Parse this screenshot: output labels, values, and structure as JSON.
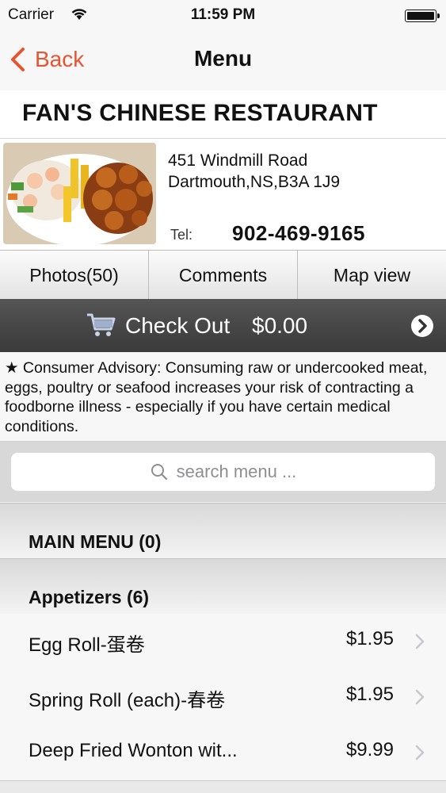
{
  "status_bar": {
    "carrier": "Carrier",
    "time": "11:59 PM"
  },
  "nav": {
    "back_label": "Back",
    "title": "Menu"
  },
  "restaurant": {
    "name": "FAN'S CHINESE RESTAURANT",
    "address_line1": "451 Windmill Road",
    "address_line2": "Dartmouth,NS,B3A 1J9",
    "tel_label": "Tel:",
    "tel": "902-469-9165"
  },
  "tabs": [
    {
      "label": "Photos(50)"
    },
    {
      "label": "Comments"
    },
    {
      "label": "Map view"
    }
  ],
  "checkout": {
    "label": "Check Out",
    "amount": "$0.00"
  },
  "advisory": "★ Consumer Advisory: Consuming raw or undercooked meat, eggs, poultry or seafood increases your risk of contracting a foodborne illness - especially if you have certain medical conditions.",
  "search": {
    "placeholder": "search menu ..."
  },
  "sections": [
    {
      "label": "MAIN MENU (0)"
    },
    {
      "label": "Appetizers (6)"
    }
  ],
  "items": [
    {
      "name": "Egg Roll-蛋卷",
      "price": "$1.95"
    },
    {
      "name": "Spring Roll (each)-春卷",
      "price": "$1.95"
    },
    {
      "name": "Deep Fried Wonton wit...",
      "price": "$9.99"
    }
  ],
  "colors": {
    "accent": "#e6552f",
    "checkout_bg": "#444444"
  }
}
